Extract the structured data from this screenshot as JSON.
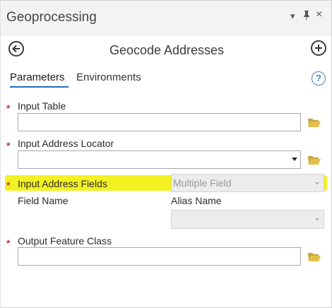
{
  "pane": {
    "title": "Geoprocessing",
    "menu_icon": "chevron-down-icon",
    "pin_icon": "pin-icon",
    "close_icon": "close-icon"
  },
  "tool": {
    "title": "Geocode Addresses",
    "back_icon": "back-arrow-icon",
    "add_icon": "plus-circle-icon"
  },
  "tabs": [
    {
      "label": "Parameters",
      "active": true
    },
    {
      "label": "Environments",
      "active": false
    }
  ],
  "help_icon_label": "?",
  "params": {
    "input_table": {
      "label": "Input Table",
      "required_mark": "*",
      "value": ""
    },
    "input_locator": {
      "label": "Input Address Locator",
      "required_mark": "*",
      "value": ""
    },
    "input_fields": {
      "label": "Input Address Fields",
      "required_mark": "*",
      "value": "Multiple Field"
    },
    "field_table": {
      "field_header": "Field Name",
      "alias_header": "Alias Name"
    },
    "output_fc": {
      "label": "Output Feature Class",
      "required_mark": "*",
      "value": ""
    }
  },
  "colors": {
    "accent": "#1f6fb2",
    "required": "#c3392b",
    "highlight": "#f2f00a",
    "folder": "#e3c04c"
  }
}
